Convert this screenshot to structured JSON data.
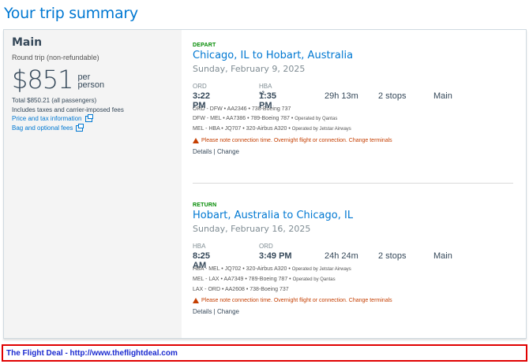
{
  "page": {
    "title": "Your trip summary"
  },
  "fare": {
    "name": "Main",
    "type": "Round trip (non-refundable)",
    "price": "$851",
    "per_person": [
      "per",
      "person"
    ],
    "total": "Total $850.21 (all passengers)",
    "includes": "Includes taxes and carrier-imposed fees",
    "links": [
      "Price and tax information",
      "Bag and optional fees"
    ]
  },
  "depart": {
    "label": "DEPART",
    "route": "Chicago, IL to Hobart, Australia",
    "date": "Sunday, February 9, 2025",
    "from_code": "ORD",
    "to_code": "HBA",
    "dep_time": "3:22 PM",
    "arr_time": "1:35 PM",
    "day_offset": "+2",
    "duration": "29h 13m",
    "stops": "2 stops",
    "cabin": "Main",
    "segments": [
      {
        "text": "ORD - DFW • AA2346 • 738-Boeing 737",
        "operated": ""
      },
      {
        "text": "DFW - MEL • AA7386 • 789-Boeing 787 • ",
        "operated": "Operated by Qantas"
      },
      {
        "text": "MEL - HBA • JQ707 • 320-Airbus A320 • ",
        "operated": "Operated by Jetstar Airways"
      }
    ],
    "warning": "Please note connection time. Overnight flight or connection. Change terminals",
    "details": "Details",
    "change": "Change"
  },
  "return": {
    "label": "RETURN",
    "route": "Hobart, Australia to Chicago, IL",
    "date": "Sunday, February 16, 2025",
    "from_code": "HBA",
    "to_code": "ORD",
    "dep_time": "8:25 AM",
    "arr_time": "3:49 PM",
    "duration": "24h 24m",
    "stops": "2 stops",
    "cabin": "Main",
    "segments": [
      {
        "text": "HBA - MEL • JQ702 • 320-Airbus A320 • ",
        "operated": "Operated by Jetstar Airways"
      },
      {
        "text": "MEL - LAX • AA7349 • 789-Boeing 787 • ",
        "operated": "Operated by Qantas"
      },
      {
        "text": "LAX - ORD • AA2608 • 738-Boeing 737",
        "operated": ""
      }
    ],
    "warning": "Please note connection time. Overnight flight or connection. Change terminals",
    "details": "Details",
    "change": "Change"
  },
  "footer": {
    "text": "The Flight Deal - http://www.theflightdeal.com"
  },
  "colors": {
    "link": "#0078d2",
    "slice_label": "#008a00",
    "warning": "#c53e00",
    "banner_border": "#e00000",
    "banner_text": "#1c2bd0"
  }
}
